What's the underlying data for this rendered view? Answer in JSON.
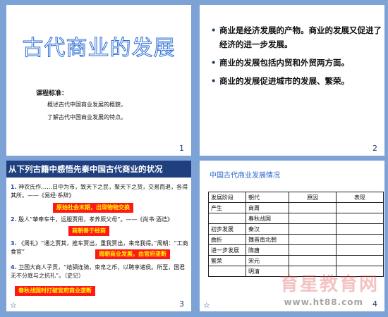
{
  "slides": [
    {
      "number": "1",
      "title": "古代商业的发展",
      "standard_label": "课程标准：",
      "standard_lines": [
        "概述古代中国商业发展的概貌，",
        "了解古代中国商业发展的特点。"
      ]
    },
    {
      "number": "2",
      "bullets": [
        "商业是经济发展的产物。商业的发展又促进了经济的进一步发展。",
        "商业的发展包括内贸和外贸两方面。",
        "商业的发展促进城市的发展、繁荣。"
      ]
    },
    {
      "number": "3",
      "title": "从下列古籍中感悟先秦中国古代商业的状况",
      "items": [
        {
          "num": "1.",
          "text": "神农氏作……日中为市，致天下之民，聚天下之货，交易而退，各得其所。——《易经·系辞》"
        },
        {
          "num": "2.",
          "text": "殷人“肇牵车牛，远服贾用，孝养厥父母”。——《尚书·酒诰》"
        },
        {
          "num": "3.",
          "text": "《周礼》“通之贾其，推车贾出，重我贾出，来帛我得。”周朝：“工商食官”"
        },
        {
          "num": "4.",
          "text": "卫国大商人子贡，“结驷连骑，束帛之币，以聘享诸侯。所至，国君无不分庭与之抗礼”。（史记）"
        }
      ],
      "highlights": [
        "原始社会末期，出现物物交换",
        "商朝善于经商",
        "周朝商业发展，由官府垄断",
        "春秋战国时打破官府商业垄断"
      ]
    },
    {
      "number": "4",
      "title": "中国古代商业发展情况",
      "table_headers": [
        "发展阶段",
        "朝代",
        "原因",
        "表现"
      ],
      "table_rows": [
        [
          "产生",
          "商周",
          "",
          ""
        ],
        [
          "",
          "春秋战国",
          "",
          ""
        ],
        [
          "初步发展",
          "秦汉",
          "",
          ""
        ],
        [
          "曲折",
          "魏晋南北朝",
          "",
          ""
        ],
        [
          "进一步发展",
          "隋唐",
          "",
          ""
        ],
        [
          "繁荣",
          "宋元",
          "",
          ""
        ],
        [
          "",
          "明清",
          "",
          ""
        ]
      ],
      "watermark": "育星教育网",
      "watermark_url": "www.ht88.com"
    }
  ]
}
